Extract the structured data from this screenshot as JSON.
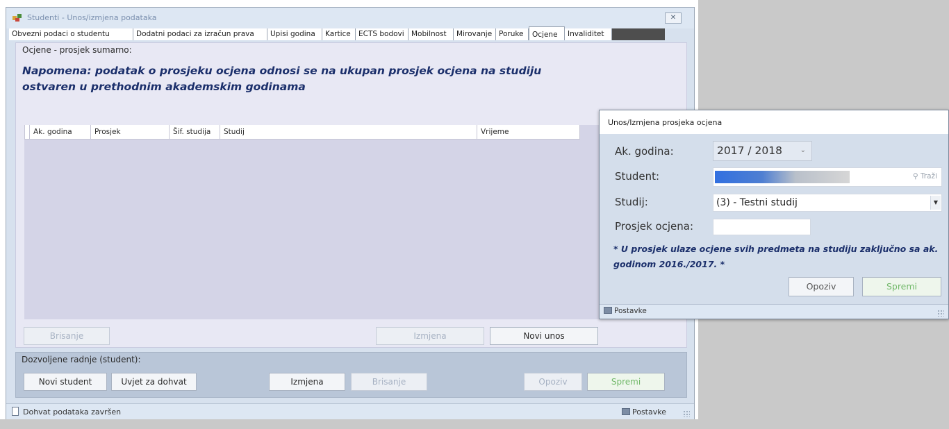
{
  "main_window": {
    "title": "Studenti - Unos/izmjena podataka",
    "close_glyph": "✕",
    "tabs": [
      {
        "label": "Obvezni podaci o studentu",
        "active": false
      },
      {
        "label": "Dodatni podaci za izračun prava",
        "active": false
      },
      {
        "label": "Upisi godina",
        "active": false
      },
      {
        "label": "Kartice",
        "active": false
      },
      {
        "label": "ECTS bodovi",
        "active": false
      },
      {
        "label": "Mobilnost",
        "active": false
      },
      {
        "label": "Mirovanje",
        "active": false
      },
      {
        "label": "Poruke",
        "active": false
      },
      {
        "label": "Ocjene",
        "active": true
      },
      {
        "label": "Invaliditet",
        "active": false
      }
    ],
    "panel": {
      "section_title": "Ocjene - prosjek sumarno:",
      "note": "Napomena: podatak o prosjeku ocjena odnosi se na ukupan prosjek ocjena na studiju ostvaren u prethodnim akademskim godinama",
      "grid_columns": [
        "Ak. godina",
        "Prosjek",
        "Šif. studija",
        "Studij",
        "Vrijeme"
      ],
      "buttons": {
        "brisanje": "Brisanje",
        "izmjena": "Izmjena",
        "novi_unos": "Novi unos"
      }
    },
    "bottom_panel": {
      "title": "Dozvoljene radnje (student):",
      "buttons": {
        "novi_student": "Novi student",
        "uvjet_za_dohvat": "Uvjet za dohvat",
        "izmjena": "Izmjena",
        "brisanje": "Brisanje",
        "opoziv": "Opoziv",
        "spremi": "Spremi"
      }
    },
    "status": {
      "text": "Dohvat podataka završen",
      "settings": "Postavke"
    }
  },
  "dialog": {
    "title": "Unos/Izmjena prosjeka ocjena",
    "fields": {
      "ak_godina_label": "Ak. godina:",
      "ak_godina_value": "2017 / 2018",
      "student_label": "Student:",
      "student_search_hint": "Traži",
      "studij_label": "Studij:",
      "studij_value": "(3) - Testni studij",
      "prosjek_label": "Prosjek ocjena:"
    },
    "note": "* U prosjek ulaze ocjene svih predmeta na studiju zaključno sa ak. godinom 2016./2017. *",
    "buttons": {
      "opoziv": "Opoziv",
      "spremi": "Spremi"
    },
    "status": {
      "settings": "Postavke"
    }
  }
}
